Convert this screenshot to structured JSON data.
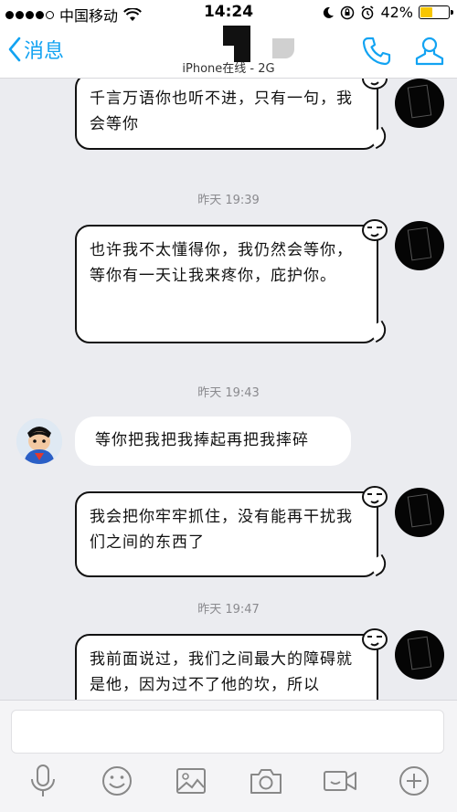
{
  "status_bar": {
    "carrier": "中国移动",
    "wifi_icon": "wifi-icon",
    "time": "14:24",
    "battery_percent_text": "42%",
    "battery_level": 0.42,
    "icons": [
      "moon-icon",
      "orientation-lock-icon",
      "alarm-icon"
    ]
  },
  "nav": {
    "back_label": "消息",
    "subtitle": "iPhone在线 - 2G",
    "icons": [
      "phone-icon",
      "profile-icon"
    ]
  },
  "messages": [
    {
      "side": "right",
      "text": "千言万语你也听不进，只有一句，我会等你"
    },
    {
      "timestamp": "昨天 19:39"
    },
    {
      "side": "right",
      "text": "也许我不太懂得你，我仍然会等你，等你有一天让我来疼你，庇护你。"
    },
    {
      "timestamp": "昨天 19:43"
    },
    {
      "side": "left",
      "text": "等你把我把我捧起再把我摔碎"
    },
    {
      "side": "right",
      "text": "我会把你牢牢抓住，没有能再干扰我们之间的东西了"
    },
    {
      "timestamp": "昨天 19:47"
    },
    {
      "side": "right",
      "text": "我前面说过，我们之间最大的障碍就是他，因为过不了他的坎，所以"
    }
  ],
  "input": {
    "value": "",
    "placeholder": ""
  },
  "toolbar": {
    "icons": [
      "microphone-icon",
      "emoji-icon",
      "image-icon",
      "camera-icon",
      "video-icon",
      "plus-icon"
    ]
  },
  "colors": {
    "accent": "#12a3f2",
    "background": "#ebecf0",
    "battery": "#f7c600"
  }
}
